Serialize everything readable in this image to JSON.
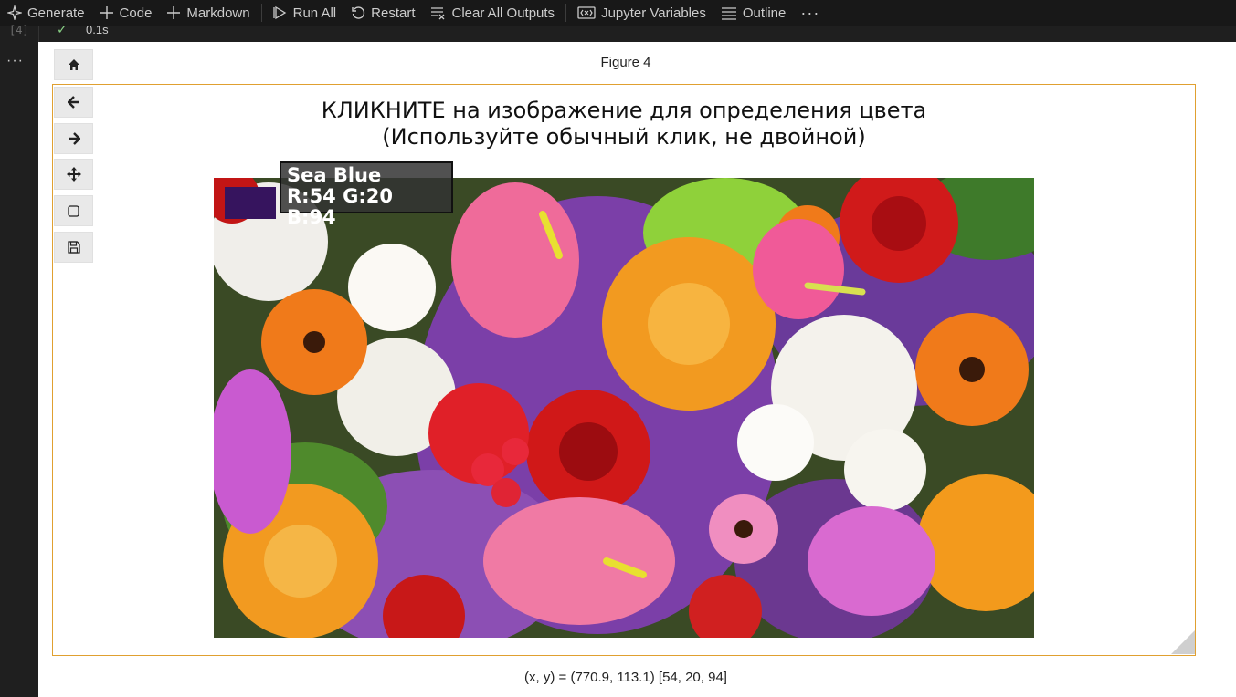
{
  "toolbar": {
    "generate": "Generate",
    "code": "Code",
    "markdown": "Markdown",
    "run_all": "Run All",
    "restart": "Restart",
    "clear_all_outputs": "Clear All Outputs",
    "jupyter_variables": "Jupyter Variables",
    "outline": "Outline",
    "more": "···"
  },
  "cell": {
    "execution_count": "[4]",
    "duration": "0.1s",
    "more": "···"
  },
  "figure": {
    "label": "Figure 4",
    "title_line1": "КЛИКНИТЕ на изображение для определения цвета",
    "title_line2": "(Используйте обычный клик, не двойной)",
    "color_name": "Sea Blue",
    "color_rgb_text": "R:54 G:20 B:94",
    "swatch_color": "#36145e",
    "status_text": "(x, y) = (770.9, 113.1) [54, 20, 94]"
  },
  "nav_toolbar": [
    "home-icon",
    "back-arrow-icon",
    "forward-arrow-icon",
    "pan-move-icon",
    "zoom-rect-icon",
    "save-icon"
  ],
  "colors": {
    "accent_border": "#e0a030",
    "run_check": "#89d185"
  }
}
